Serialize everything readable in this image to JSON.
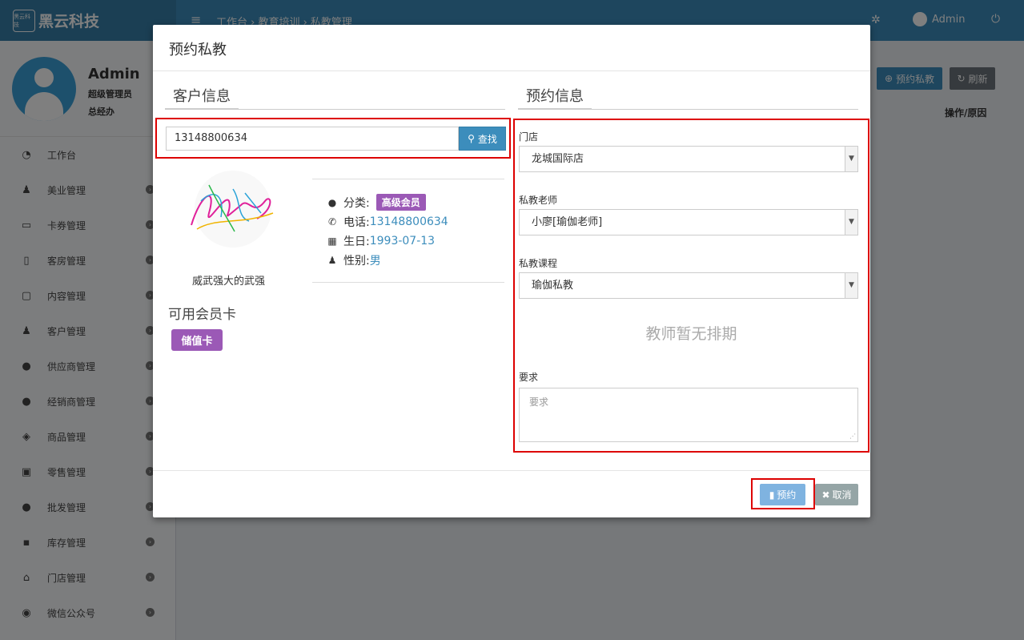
{
  "app": {
    "brand_logo_text": "黑云科技",
    "brand": "黑云科技",
    "breadcrumb": "工作台 › 教育培训 › 私教管理",
    "username": "Admin"
  },
  "sidebar": {
    "user": {
      "name": "Admin",
      "role": "超级管理员",
      "dept": "总经办"
    },
    "items": [
      {
        "label": "工作台",
        "icon": "dashboard-icon",
        "glyph": "◔"
      },
      {
        "label": "美业管理",
        "icon": "person-icon",
        "glyph": "♟"
      },
      {
        "label": "卡券管理",
        "icon": "credit-card-icon",
        "glyph": "▭"
      },
      {
        "label": "客房管理",
        "icon": "building-icon",
        "glyph": "▯"
      },
      {
        "label": "内容管理",
        "icon": "file-icon",
        "glyph": "▢"
      },
      {
        "label": "客户管理",
        "icon": "person-icon",
        "glyph": "♟"
      },
      {
        "label": "供应商管理",
        "icon": "user-icon",
        "glyph": "●"
      },
      {
        "label": "经销商管理",
        "icon": "users-icon",
        "glyph": "●"
      },
      {
        "label": "商品管理",
        "icon": "cubes-icon",
        "glyph": "◈"
      },
      {
        "label": "零售管理",
        "icon": "money-icon",
        "glyph": "▣"
      },
      {
        "label": "批发管理",
        "icon": "users-icon",
        "glyph": "●"
      },
      {
        "label": "库存管理",
        "icon": "archive-icon",
        "glyph": "▪"
      },
      {
        "label": "门店管理",
        "icon": "home-icon",
        "glyph": "⌂"
      },
      {
        "label": "微信公众号",
        "icon": "wechat-icon",
        "glyph": "◉"
      }
    ]
  },
  "background": {
    "book_button": "预约私教",
    "refresh_button": "刷新",
    "ops_column": "操作/原因"
  },
  "modal": {
    "title": "预约私教",
    "customer_section": "客户信息",
    "booking_section": "预约信息",
    "search": {
      "value": "13148800634",
      "button": "查找"
    },
    "customer": {
      "name": "威武强大的武强",
      "category_label": "分类:",
      "category": "高级会员",
      "phone_label": "电话:",
      "phone": "13148800634",
      "birthday_label": "生日:",
      "birthday": "1993-07-13",
      "gender_label": "性别:",
      "gender": "男"
    },
    "cards_title": "可用会员卡",
    "card_badge": "储值卡",
    "form": {
      "store_label": "门店",
      "store_value": "龙城国际店",
      "teacher_label": "私教老师",
      "teacher_value": "小廖[瑜伽老师]",
      "course_label": "私教课程",
      "course_value": "瑜伽私教",
      "no_schedule": "教师暂无排期",
      "requirement_label": "要求",
      "requirement_placeholder": "要求"
    },
    "confirm_button": "预约",
    "cancel_button": "取消"
  },
  "colors": {
    "primary": "#3c8dbc",
    "badge_purple": "#9b59b6",
    "highlight_red": "#dd0000"
  }
}
